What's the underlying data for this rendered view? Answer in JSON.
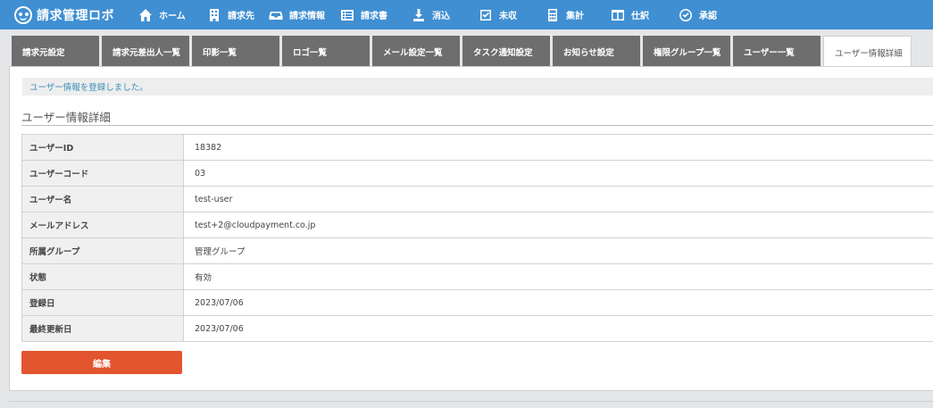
{
  "app": {
    "logo_text": "請求管理ロボ"
  },
  "nav": [
    {
      "label": "ホーム",
      "icon": "home-icon"
    },
    {
      "label": "請求先",
      "icon": "building-icon"
    },
    {
      "label": "請求情報",
      "icon": "inbox-icon"
    },
    {
      "label": "請求書",
      "icon": "invoice-icon"
    },
    {
      "label": "消込",
      "icon": "download-icon"
    },
    {
      "label": "未収",
      "icon": "checkbox-icon"
    },
    {
      "label": "集計",
      "icon": "calculator-icon"
    },
    {
      "label": "仕訳",
      "icon": "journal-icon"
    },
    {
      "label": "承認",
      "icon": "check-circle-icon"
    }
  ],
  "tabs": [
    {
      "label": "請求元設定"
    },
    {
      "label": "請求元差出人一覧"
    },
    {
      "label": "印影一覧"
    },
    {
      "label": "ロゴ一覧"
    },
    {
      "label": "メール設定一覧"
    },
    {
      "label": "タスク通知設定"
    },
    {
      "label": "お知らせ設定"
    },
    {
      "label": "権限グループ一覧"
    },
    {
      "label": "ユーザー一覧"
    },
    {
      "label": "ユーザー情報詳細"
    }
  ],
  "active_tab_index": 9,
  "notice": "ユーザー情報を登録しました。",
  "section_title": "ユーザー情報詳細",
  "details": [
    {
      "label": "ユーザーID",
      "value": "18382"
    },
    {
      "label": "ユーザーコード",
      "value": "03"
    },
    {
      "label": "ユーザー名",
      "value": "test-user"
    },
    {
      "label": "メールアドレス",
      "value": "test+2@cloudpayment.co.jp"
    },
    {
      "label": "所属グループ",
      "value": "管理グループ"
    },
    {
      "label": "状態",
      "value": "有効"
    },
    {
      "label": "登録日",
      "value": "2023/07/06"
    },
    {
      "label": "最終更新日",
      "value": "2023/07/06"
    }
  ],
  "edit_button": "編集",
  "colors": {
    "nav_bg": "#3f8fd2",
    "tab_bg": "#6e6e6e",
    "accent_button": "#e2552e",
    "notice_text": "#3a8fb7"
  }
}
